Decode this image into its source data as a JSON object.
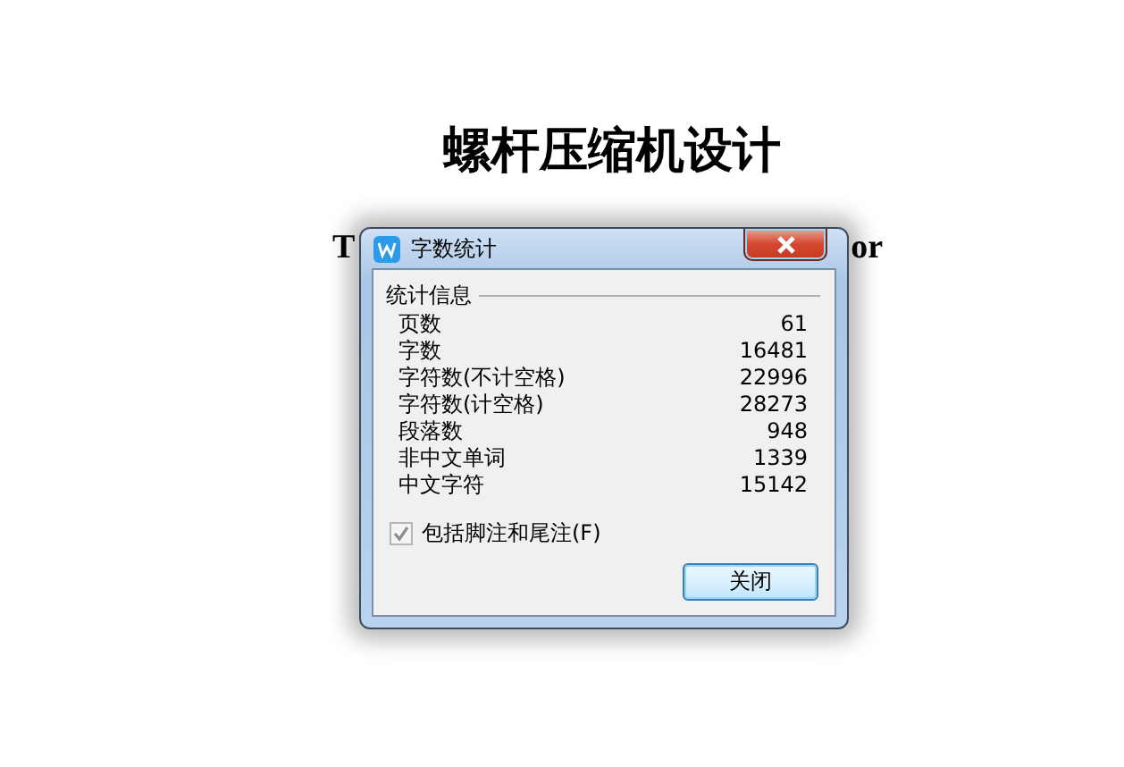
{
  "document": {
    "title": "螺杆压缩机设计",
    "subtitle_fragments": [
      "T",
      "or"
    ]
  },
  "dialog": {
    "title": "字数统计",
    "group_label": "统计信息",
    "stats": [
      {
        "label": "页数",
        "value": "61"
      },
      {
        "label": "字数",
        "value": "16481"
      },
      {
        "label": "字符数(不计空格)",
        "value": "22996"
      },
      {
        "label": "字符数(计空格)",
        "value": "28273"
      },
      {
        "label": "段落数",
        "value": "948"
      },
      {
        "label": "非中文单词",
        "value": "1339"
      },
      {
        "label": "中文字符",
        "value": "15142"
      }
    ],
    "include_footnotes": {
      "label": "包括脚注和尾注(F)",
      "checked": true,
      "disabled": true
    },
    "buttons": [
      "关闭"
    ]
  }
}
